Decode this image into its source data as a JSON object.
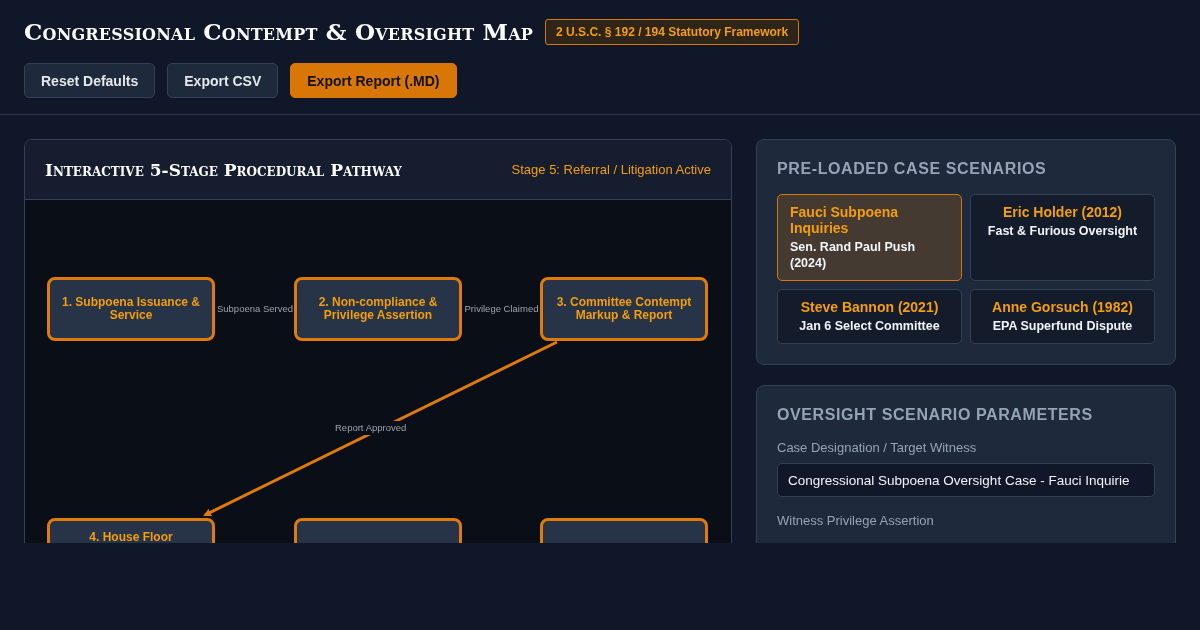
{
  "header": {
    "title": "Congressional Contempt & Oversight Map",
    "badge": "2 U.S.C. § 192 / 194 Statutory Framework"
  },
  "toolbar": [
    {
      "label": "Reset Defaults",
      "kind": "secondary"
    },
    {
      "label": "Export CSV",
      "kind": "secondary"
    },
    {
      "label": "Export Report (.MD)",
      "kind": "primary"
    }
  ],
  "pathway": {
    "title": "Interactive 5-Stage Procedural Pathway",
    "status": "Stage 5: Referral / Litigation Active",
    "nodes": [
      {
        "label": "1. Subpoena Issuance & Service",
        "kind": "full"
      },
      {
        "label": "2. Non-compliance & Privilege Assertion",
        "kind": "full"
      },
      {
        "label": "3. Committee Contempt Markup & Report",
        "kind": "full"
      },
      {
        "label": "4. House Floor",
        "kind": "clipped"
      },
      {
        "kind": "clipped"
      },
      {
        "kind": "clipped"
      }
    ],
    "edges": [
      {
        "label": "Subpoena Served"
      },
      {
        "label": "Privilege Claimed"
      },
      {
        "label": "Report Approved"
      }
    ]
  },
  "scenarios": {
    "title": "PRE-LOADED CASE SCENARIOS",
    "items": [
      {
        "name": "Fauci Subpoena Inquiries",
        "subtitle": "Sen. Rand Paul Push (2024)",
        "selected": true
      },
      {
        "name": "Eric Holder (2012)",
        "subtitle": "Fast & Furious Oversight",
        "selected": false
      },
      {
        "name": "Steve Bannon (2021)",
        "subtitle": "Jan 6 Select Committee",
        "selected": false
      },
      {
        "name": "Anne Gorsuch (1982)",
        "subtitle": "EPA Superfund Dispute",
        "selected": false
      }
    ]
  },
  "parameters": {
    "title": "OVERSIGHT SCENARIO PARAMETERS",
    "fields": [
      {
        "label": "Case Designation / Target Witness",
        "value": "Congressional Subpoena Oversight Case - Fauci Inquirie"
      },
      {
        "label": "Witness Privilege Assertion"
      }
    ]
  }
}
